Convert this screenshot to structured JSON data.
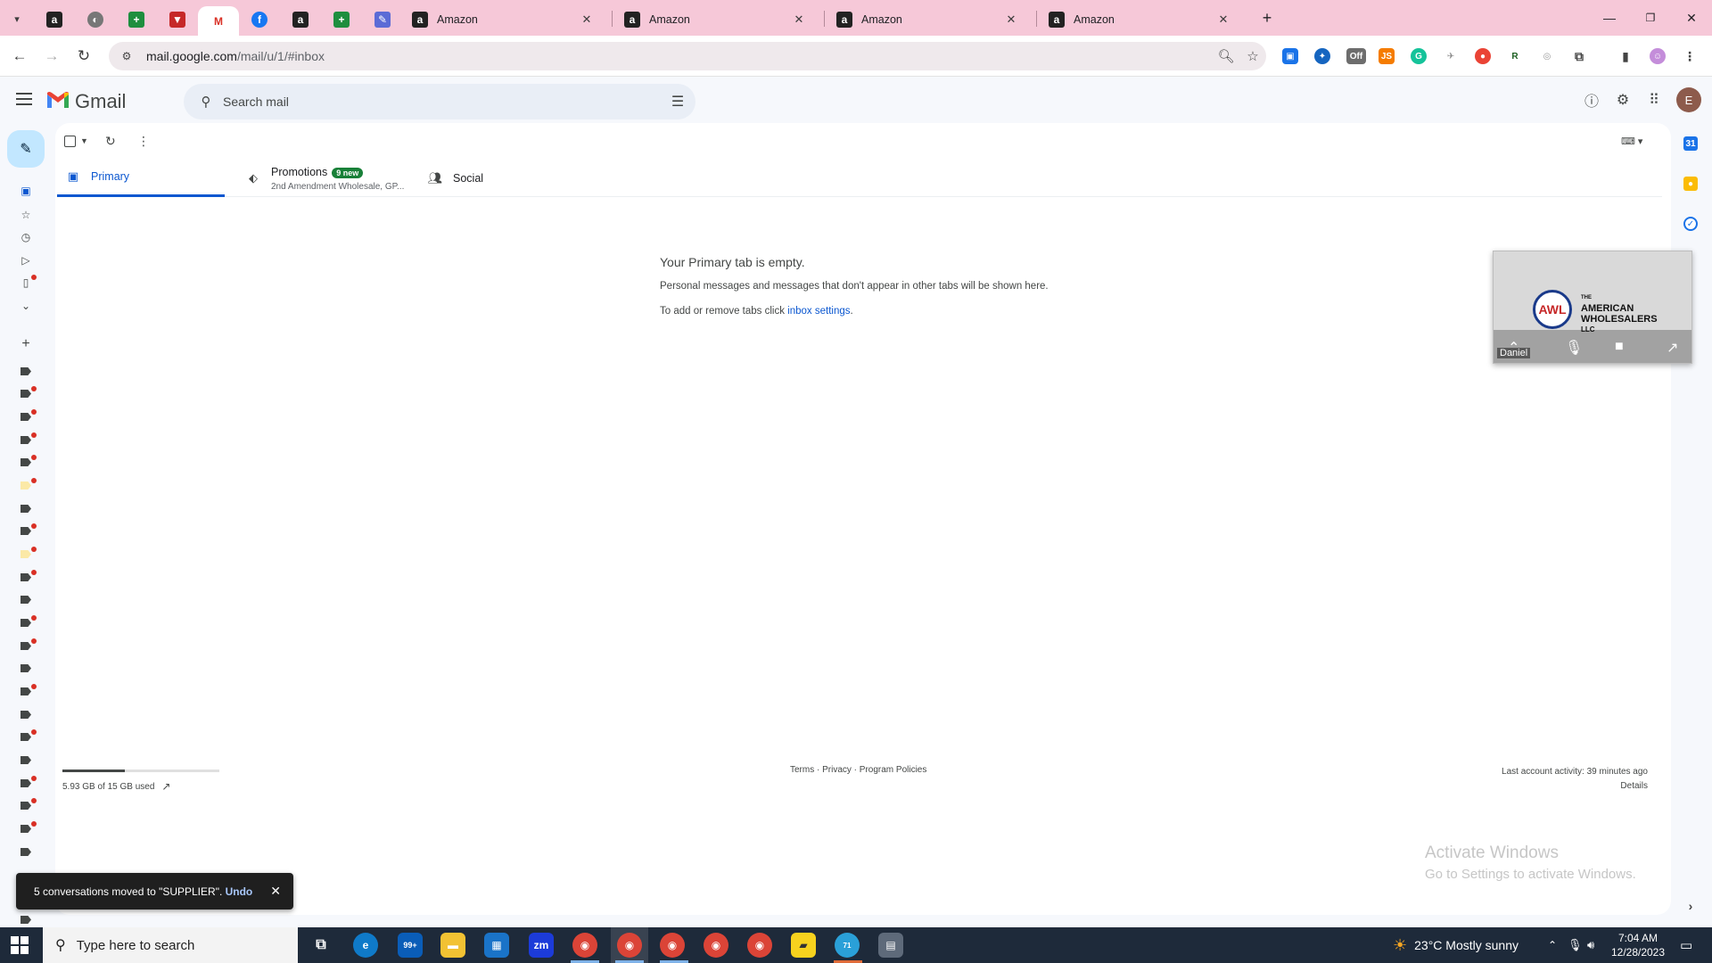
{
  "browser": {
    "tabs": [
      {
        "label": "Amazon"
      },
      {
        "label": "Amazon"
      },
      {
        "label": "Amazon"
      },
      {
        "label": "Amazon"
      }
    ],
    "url_domain": "mail.google.com",
    "url_path": "/mail/u/1/#inbox",
    "extension_badges": {
      "off_label": "Off",
      "js_label": "JS"
    }
  },
  "gmail": {
    "app_name": "Gmail",
    "search_placeholder": "Search mail",
    "avatar_initial": "E",
    "tabs": [
      {
        "label": "Primary"
      },
      {
        "label": "Promotions",
        "badge": "9 new",
        "subtitle": "2nd Amendment Wholesale, GP..."
      },
      {
        "label": "Social"
      }
    ],
    "empty": {
      "title": "Your Primary tab is empty.",
      "line1": "Personal messages and messages that don't appear in other tabs will be shown here.",
      "line2_prefix": "To add or remove tabs click ",
      "line2_link": "inbox settings",
      "line2_suffix": "."
    },
    "storage": {
      "text": "5.93 GB of 15 GB used",
      "fraction": 0.395
    },
    "footer_links": "Terms · Privacy · Program Policies",
    "last_activity": "Last account activity: 39 minutes ago",
    "details_link": "Details"
  },
  "video_overlay": {
    "brand_line1": "THE",
    "brand_line2": "AMERICAN",
    "brand_line3": "WHOLESALERS",
    "brand_line4": "LLC",
    "logo_text": "AWL",
    "participant": "Daniel"
  },
  "snackbar": {
    "message": "5 conversations moved to \"SUPPLIER\".",
    "action": "Undo"
  },
  "watermark": {
    "line1": "Activate Windows",
    "line2": "Go to Settings to activate Windows."
  },
  "taskbar": {
    "search_placeholder": "Type here to search",
    "mail_badge": "99+",
    "zoom_label": "zm",
    "telegram_badge": "71",
    "weather": "23°C  Mostly sunny",
    "time": "7:04 AM",
    "date": "12/28/2023"
  },
  "colors": {
    "tabstrip": "#f6c8d8",
    "gmail_blue": "#0b57d0",
    "compose_bg": "#c2e7ff",
    "promo_badge": "#188038",
    "taskbar": "#1e2a3a"
  }
}
